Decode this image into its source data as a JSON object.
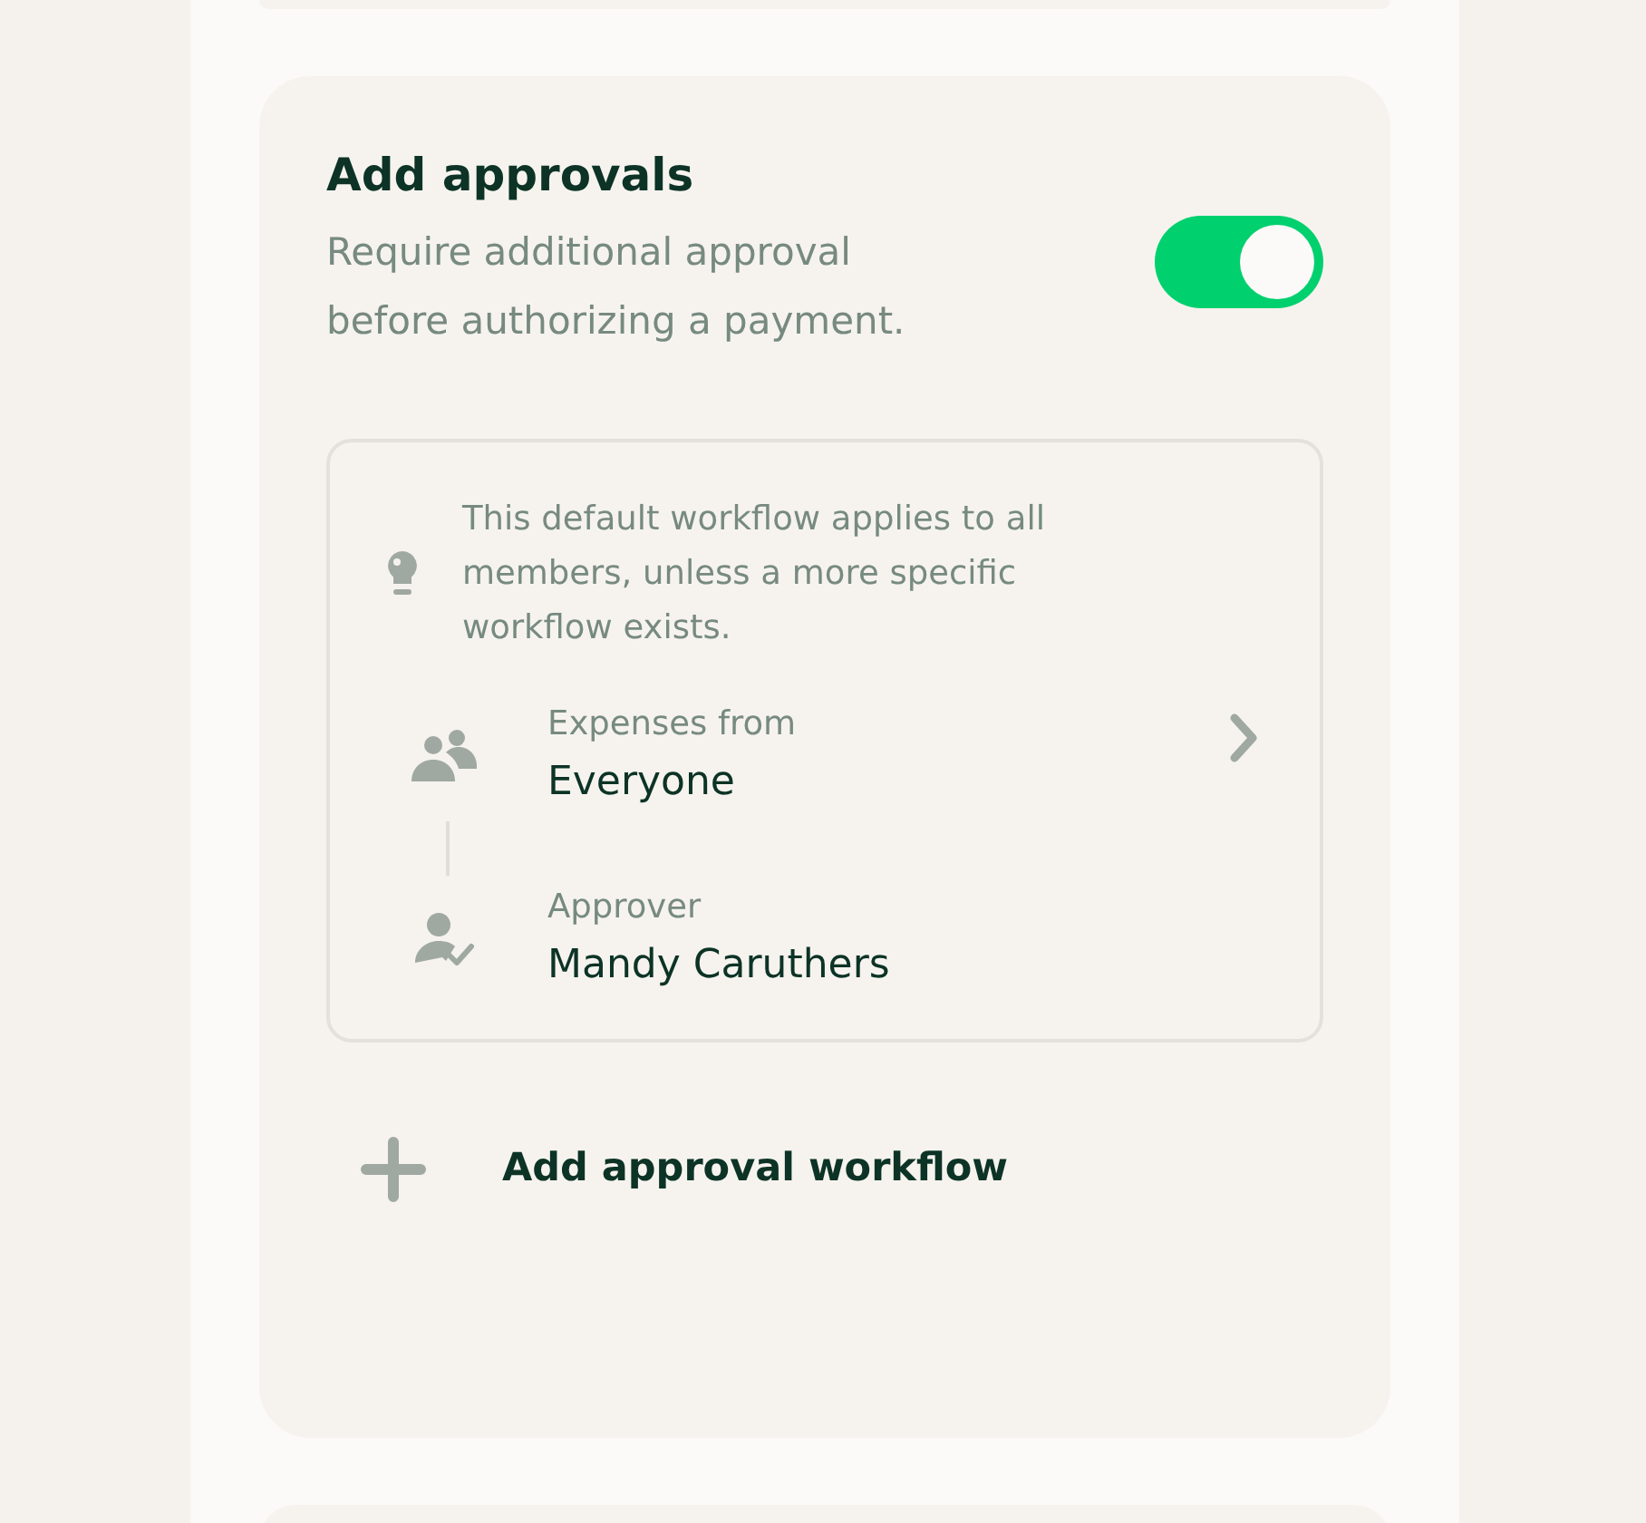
{
  "section": {
    "title": "Add approvals",
    "description": "Require additional approval before authorizing a payment.",
    "toggle": {
      "on": true
    }
  },
  "workflow": {
    "hint": "This default workflow applies to all members, unless a more specific workflow exists.",
    "steps": [
      {
        "kind": "group",
        "label": "Expenses from",
        "value": "Everyone",
        "chevron": true
      },
      {
        "kind": "approver",
        "label": "Approver",
        "value": "Mandy Caruthers",
        "chevron": false
      }
    ]
  },
  "add_button": {
    "label": "Add approval workflow"
  }
}
